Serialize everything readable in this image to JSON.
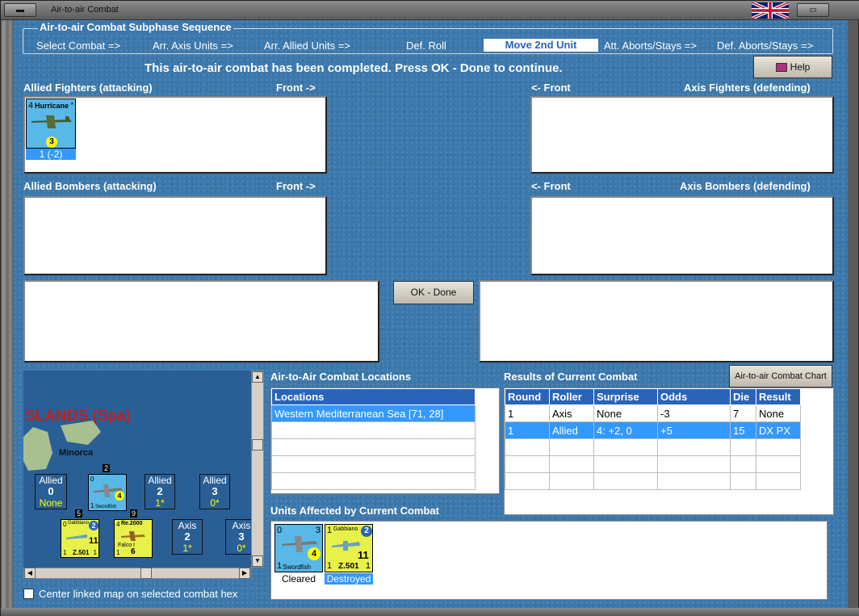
{
  "window": {
    "title": "Air-to-air Combat"
  },
  "sequence": {
    "legend": "Air-to-air Combat Subphase Sequence",
    "steps": [
      "Select Combat =>",
      "Arr. Axis Units =>",
      "Arr. Allied Units =>",
      "Def. Roll",
      "Move 2nd Unit",
      "Att. Aborts/Stays =>",
      "Def. Aborts/Stays =>"
    ],
    "active_index": 4
  },
  "status_message": "This air-to-air combat has been completed.  Press OK - Done to continue.",
  "help_button": "Help",
  "labels": {
    "allied_fighters": "Allied Fighters (attacking)",
    "front_right": "Front ->",
    "front_left": "<- Front",
    "axis_fighters": "Axis Fighters (defending)",
    "allied_bombers": "Allied Bombers (attacking)",
    "axis_bombers": "Axis Bombers (defending)"
  },
  "allied_fighter_unit": {
    "name": "Hurricane",
    "top_left": "4",
    "star": "*",
    "strength": "3",
    "caption": "1 (-2)"
  },
  "ok_button": "OK - Done",
  "map": {
    "region_label": "SLANDS (Spa)",
    "island_label": "Minorca",
    "boxes": [
      {
        "title": "Allied",
        "value": "0",
        "sub": "None"
      },
      {
        "title": "Allied",
        "value": "2",
        "sub": "1*"
      },
      {
        "title": "Allied",
        "value": "3",
        "sub": "0*"
      },
      {
        "title": "Axis",
        "value": "2",
        "sub": "1*"
      },
      {
        "title": "Axis",
        "value": "3",
        "sub": "0*"
      }
    ],
    "stack_numbers": [
      "2",
      "5",
      "9"
    ],
    "swordfish": {
      "name": "Swordfish",
      "top_left": "0",
      "bottom_left": "1",
      "strength": "4"
    },
    "gabbiano": {
      "name": "Gabbiano",
      "top_left": "0",
      "range": "2",
      "strength": "11",
      "bottom_left": "1",
      "bottom_right": "1",
      "model": "Z.501"
    },
    "re2000": {
      "name": "Re.2000",
      "top_left": "4",
      "sub": "Falco I",
      "strength": "6",
      "bottom_left": "1"
    }
  },
  "center_checkbox": {
    "label": "Center linked map on selected combat hex",
    "checked": false
  },
  "locations": {
    "title": "Air-to-Air Combat Locations",
    "header": "Locations",
    "rows": [
      "Western Mediterranean Sea [71, 28]",
      "",
      "",
      "",
      ""
    ]
  },
  "results": {
    "title": "Results of Current Combat",
    "chart_button": "Air-to-air Combat Chart",
    "columns": [
      "Round",
      "Roller",
      "Surprise",
      "Odds",
      "Die",
      "Result"
    ],
    "rows": [
      [
        "1",
        "Axis",
        "None",
        "-3",
        "7",
        "None"
      ],
      [
        "1",
        "Allied",
        "4: +2, 0",
        "+5",
        "15",
        "DX PX"
      ],
      [
        "",
        "",
        "",
        "",
        "",
        ""
      ],
      [
        "",
        "",
        "",
        "",
        "",
        ""
      ],
      [
        "",
        "",
        "",
        "",
        "",
        ""
      ]
    ],
    "selected_row": 1
  },
  "affected": {
    "title": "Units Affected by Current Combat",
    "units": [
      {
        "name": "Swordfish",
        "top_left": "0",
        "top_right": "3",
        "strength": "4",
        "bottom_left": "1",
        "status": "Cleared"
      },
      {
        "name": "Gabbiano",
        "top_left": "1",
        "range": "2",
        "strength": "11",
        "bottom_left": "1",
        "bottom_right": "1",
        "model": "Z.501",
        "status": "Destroyed"
      }
    ]
  },
  "colors": {
    "background": "#3c78ac",
    "header_blue": "#2a64b8",
    "selection": "#3399ff",
    "italian_counter": "#e8f04a",
    "allied_counter": "#58b8e8"
  }
}
